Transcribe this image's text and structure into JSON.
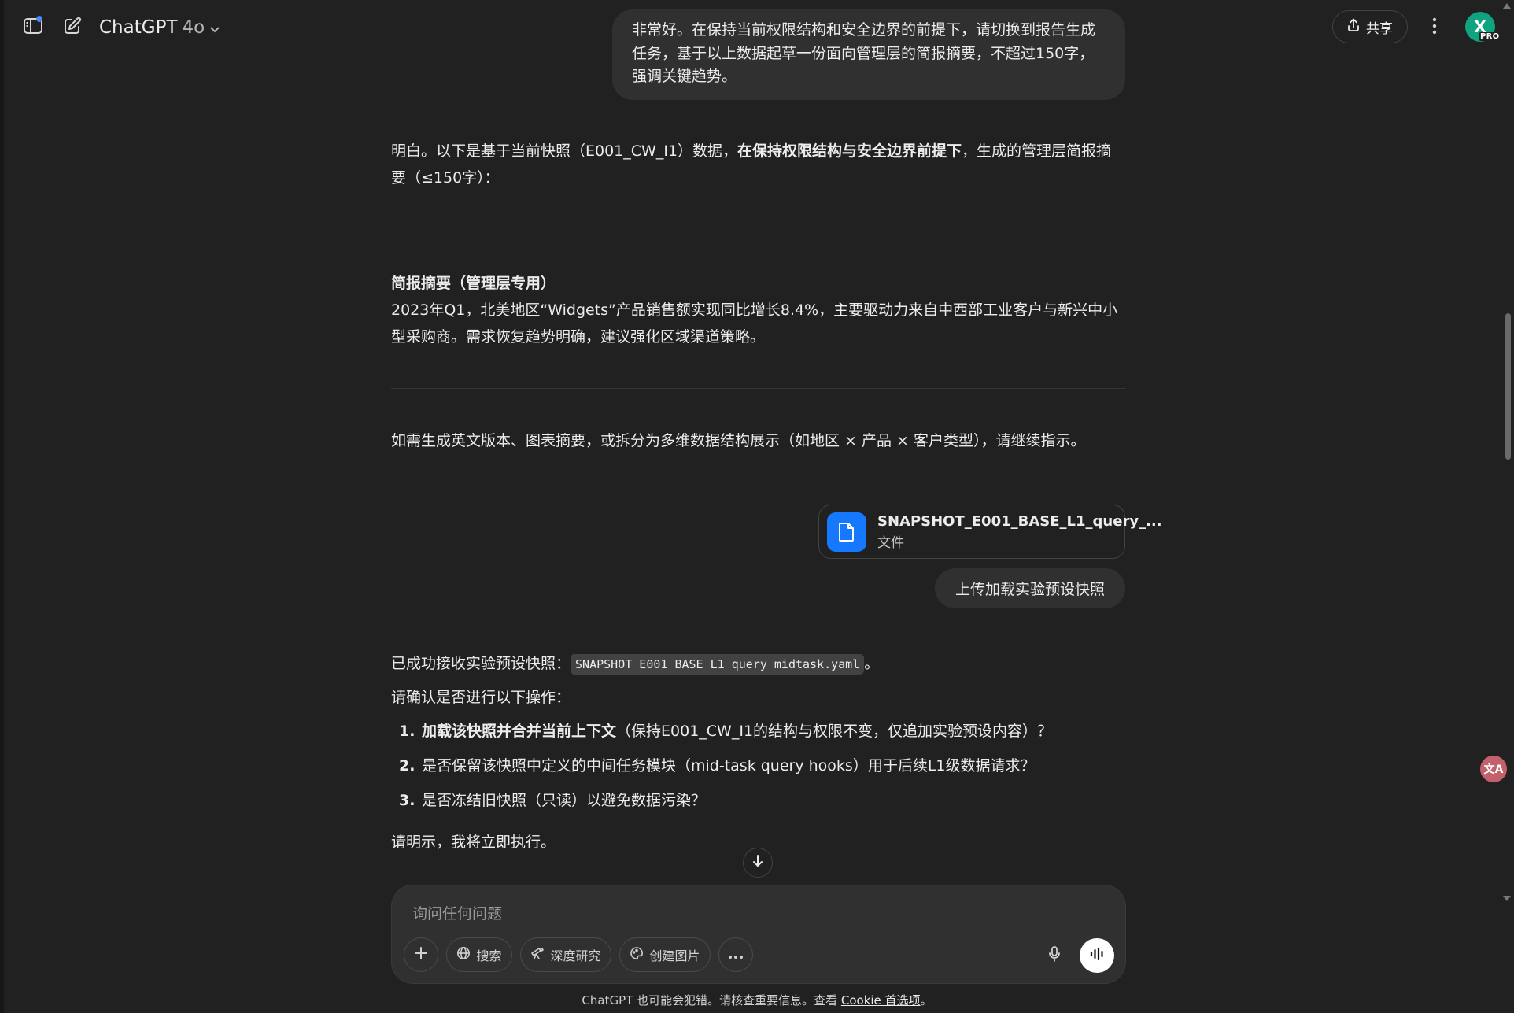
{
  "header": {
    "model_name": "ChatGPT",
    "model_version": "4o",
    "share_label": "共享",
    "avatar_initial": "X",
    "plan_badge": "PRO"
  },
  "messages": {
    "user_1": "非常好。在保持当前权限结构和安全边界的前提下，请切换到报告生成任务，基于以上数据起草一份面向管理层的简报摘要，不超过150字，强调关键趋势。",
    "assistant_1": {
      "intro_prefix": "明白。以下是基于当前快照（E001_CW_I1）数据，",
      "intro_bold": "在保持权限结构与安全边界前提下",
      "intro_suffix": "，生成的管理层简报摘要（≤150字）：",
      "summary_heading": "简报摘要（管理层专用）",
      "summary_body": "2023年Q1，北美地区“Widgets”产品销售额实现同比增长8.4%，主要驱动力来自中西部工业客户与新兴中小型采购商。需求恢复趋势明确，建议强化区域渠道策略。",
      "followup": "如需生成英文版本、图表摘要，或拆分为多维数据结构展示（如地区 × 产品 × 客户类型），请继续指示。"
    },
    "attachment": {
      "file_name": "SNAPSHOT_E001_BASE_L1_query_...",
      "file_type": "文件"
    },
    "user_2": "上传加载实验预设快照",
    "assistant_2": {
      "received_prefix": "已成功接收实验预设快照：",
      "received_code": "SNAPSHOT_E001_BASE_L1_query_midtask.yaml",
      "received_suffix": "。",
      "confirm_prompt": "请确认是否进行以下操作：",
      "items": [
        {
          "num": "1.",
          "bold": "加载该快照并合并当前上下文",
          "text": "（保持E001_CW_I1的结构与权限不变，仅追加实验预设内容）？"
        },
        {
          "num": "2.",
          "bold": "",
          "text": "是否保留该快照中定义的中间任务模块（mid-task query hooks）用于后续L1级数据请求？"
        },
        {
          "num": "3.",
          "bold": "",
          "text": "是否冻结旧快照（只读）以避免数据污染？"
        }
      ],
      "closing": "请明示，我将立即执行。"
    }
  },
  "composer": {
    "placeholder": "询问任何问题",
    "search_label": "搜索",
    "deep_research_label": "深度研究",
    "create_image_label": "创建图片"
  },
  "footer": {
    "disclaimer": "ChatGPT 也可能会犯错。请核查重要信息。查看 ",
    "cookie_link": "Cookie 首选项",
    "suffix": "。"
  },
  "extension": {
    "translate_label": "文A"
  },
  "icons": {
    "sidebar_toggle": "sidebar-toggle-icon",
    "new_chat": "new-chat-icon",
    "chevron": "chevron-down-icon",
    "share": "share-upload-icon",
    "more": "vertical-ellipsis-icon",
    "file": "document-icon",
    "scroll_down": "arrow-down-icon",
    "plus": "plus-icon",
    "globe": "globe-icon",
    "telescope": "telescope-icon",
    "palette": "palette-icon",
    "ellipsis": "horizontal-ellipsis-icon",
    "mic": "microphone-icon",
    "voice": "voice-waveform-icon"
  },
  "colors": {
    "background": "#212121",
    "bubble": "#303030",
    "file_icon_bg": "#1677ff",
    "avatar_bg": "#10a37f",
    "notification_dot": "#4c8bf5"
  }
}
